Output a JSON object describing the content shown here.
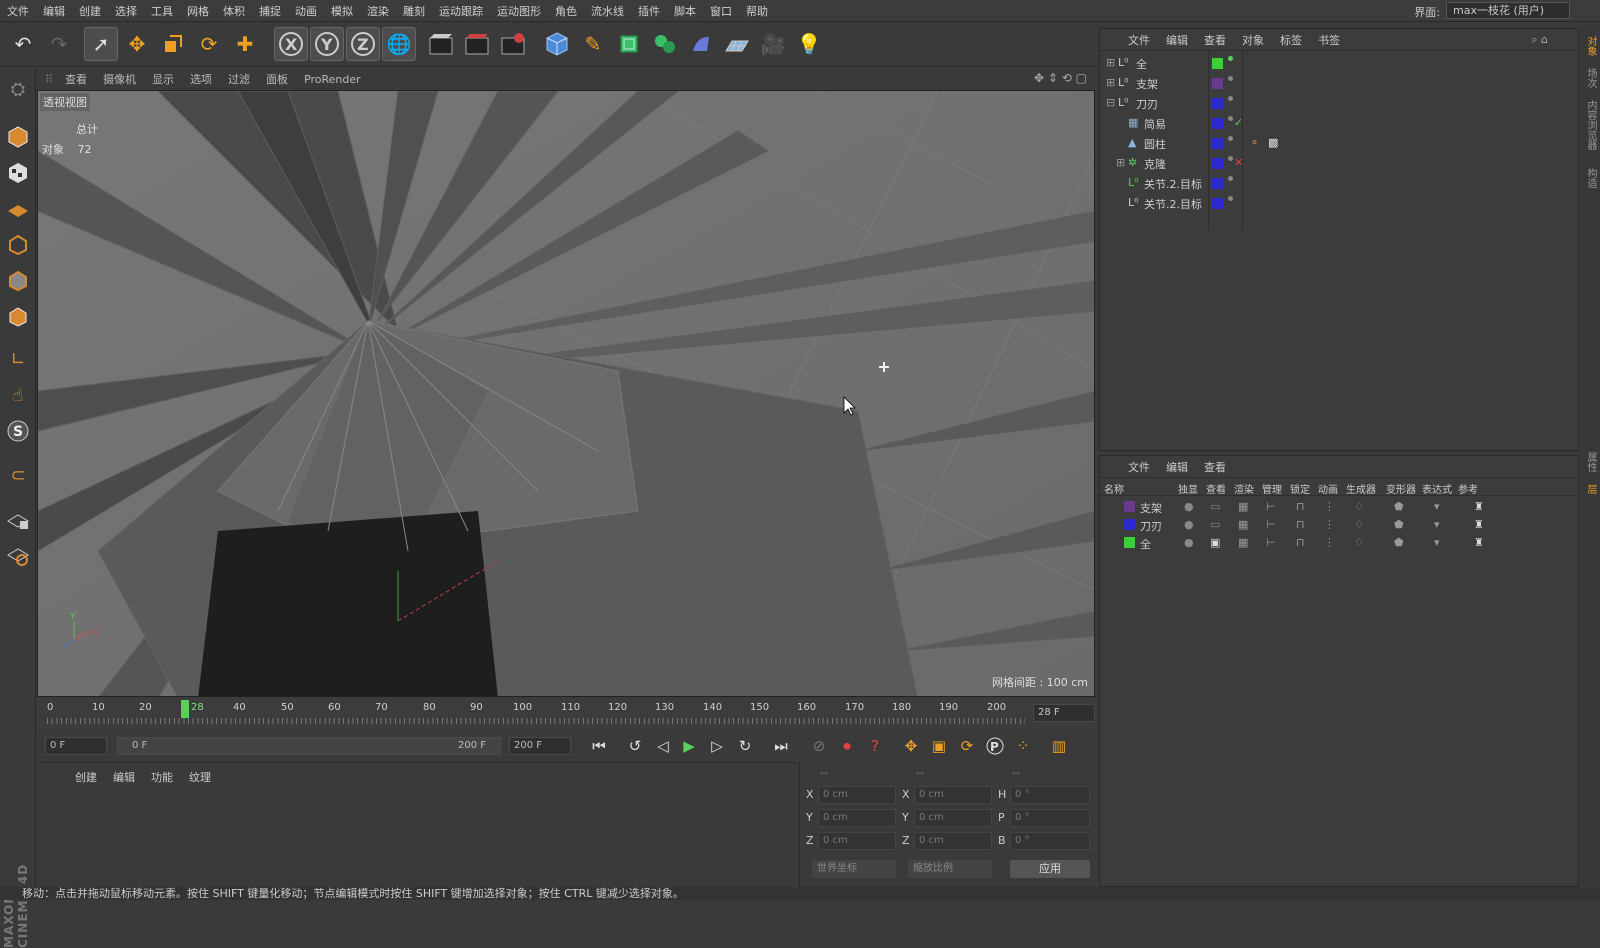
{
  "menubar": {
    "items": [
      "文件",
      "编辑",
      "创建",
      "选择",
      "工具",
      "网格",
      "体积",
      "捕捉",
      "动画",
      "模拟",
      "渲染",
      "雕刻",
      "运动跟踪",
      "运动图形",
      "角色",
      "流水线",
      "插件",
      "脚本",
      "窗口",
      "帮助"
    ],
    "layout_label": "界面:",
    "layout_value": "max一枝花 (用户)"
  },
  "toolbar": {
    "icons": [
      "undo-icon",
      "redo-icon",
      "select-arrow-icon",
      "move-icon",
      "scale-icon",
      "rotate-icon",
      "live-select-icon",
      "x-axis-icon",
      "y-axis-icon",
      "z-axis-icon",
      "world-coord-icon",
      "render-view-icon",
      "render-picture-viewer-icon",
      "render-settings-icon",
      "cube-icon",
      "pen-icon",
      "subdivision-icon",
      "array-icon",
      "deformer-icon",
      "floor-icon",
      "camera-icon",
      "light-icon"
    ]
  },
  "viewport": {
    "menu": [
      "查看",
      "摄像机",
      "显示",
      "选项",
      "过滤",
      "面板",
      "ProRender"
    ],
    "label": "透视视图",
    "stats_header": "总计",
    "stats_label": "对象",
    "stats_value": "72",
    "grid_spacing": "网格间距 : 100 cm"
  },
  "timeline": {
    "ticks": [
      "0",
      "10",
      "20",
      "28",
      "40",
      "50",
      "60",
      "70",
      "80",
      "90",
      "100",
      "110",
      "120",
      "130",
      "140",
      "150",
      "160",
      "170",
      "180",
      "190",
      "200"
    ],
    "current_frame": 28,
    "end_field": "28 F"
  },
  "transport": {
    "start_field": "0 F",
    "range_start": "0 F",
    "range_end": "200 F",
    "end_field": "200 F"
  },
  "material": {
    "menu": [
      "创建",
      "编辑",
      "功能",
      "纹理"
    ]
  },
  "coords": {
    "header": [
      "--",
      "--",
      "--"
    ],
    "labels_pos": [
      "X",
      "Y",
      "Z"
    ],
    "values_pos": [
      "0 cm",
      "0 cm",
      "0 cm"
    ],
    "labels_size": [
      "X",
      "Y",
      "Z"
    ],
    "values_size": [
      "0 cm",
      "0 cm",
      "0 cm"
    ],
    "labels_rot": [
      "H",
      "P",
      "B"
    ],
    "values_rot": [
      "0 °",
      "0 °",
      "0 °"
    ],
    "mode_world": "世界坐标",
    "mode_scale": "缩放比例",
    "apply": "应用"
  },
  "status": "移动：点击并拖动鼠标移动元素。按住 SHIFT 键量化移动；节点编辑模式时按住 SHIFT 键增加选择对象；按住 CTRL 键减少选择对象。",
  "object_manager": {
    "menu": [
      "文件",
      "编辑",
      "查看",
      "对象",
      "标签",
      "书签"
    ],
    "rows": [
      {
        "name": "全",
        "color": "#3ad03a",
        "indent": 0
      },
      {
        "name": "支架",
        "color": "#6a3a8a",
        "indent": 0
      },
      {
        "name": "刀刃",
        "color": "#2a2ad0",
        "indent": 0
      },
      {
        "name": "简易",
        "color": "#2a2ad0",
        "indent": 1
      },
      {
        "name": "圆柱",
        "color": "#2a2ad0",
        "indent": 1
      },
      {
        "name": "克隆",
        "color": "#2a2ad0",
        "indent": 1
      },
      {
        "name": "关节.2.目标",
        "color": "#2a2ad0",
        "indent": 1
      },
      {
        "name": "关节.2.目标",
        "color": "#2a2ad0",
        "indent": 1
      }
    ]
  },
  "layer_manager": {
    "menu": [
      "文件",
      "编辑",
      "查看"
    ],
    "headers": [
      "名称",
      "独显",
      "查看",
      "渲染",
      "管理",
      "锁定",
      "动画",
      "生成器",
      "变形器",
      "表达式",
      "参考"
    ],
    "rows": [
      {
        "name": "支架",
        "color": "#6a3a8a"
      },
      {
        "name": "刀刃",
        "color": "#2a2ad0"
      },
      {
        "name": "全",
        "color": "#3ad03a"
      }
    ]
  },
  "right_tabs": [
    "对象",
    "场次",
    "内容浏览器",
    "构造",
    "属性",
    "层"
  ]
}
